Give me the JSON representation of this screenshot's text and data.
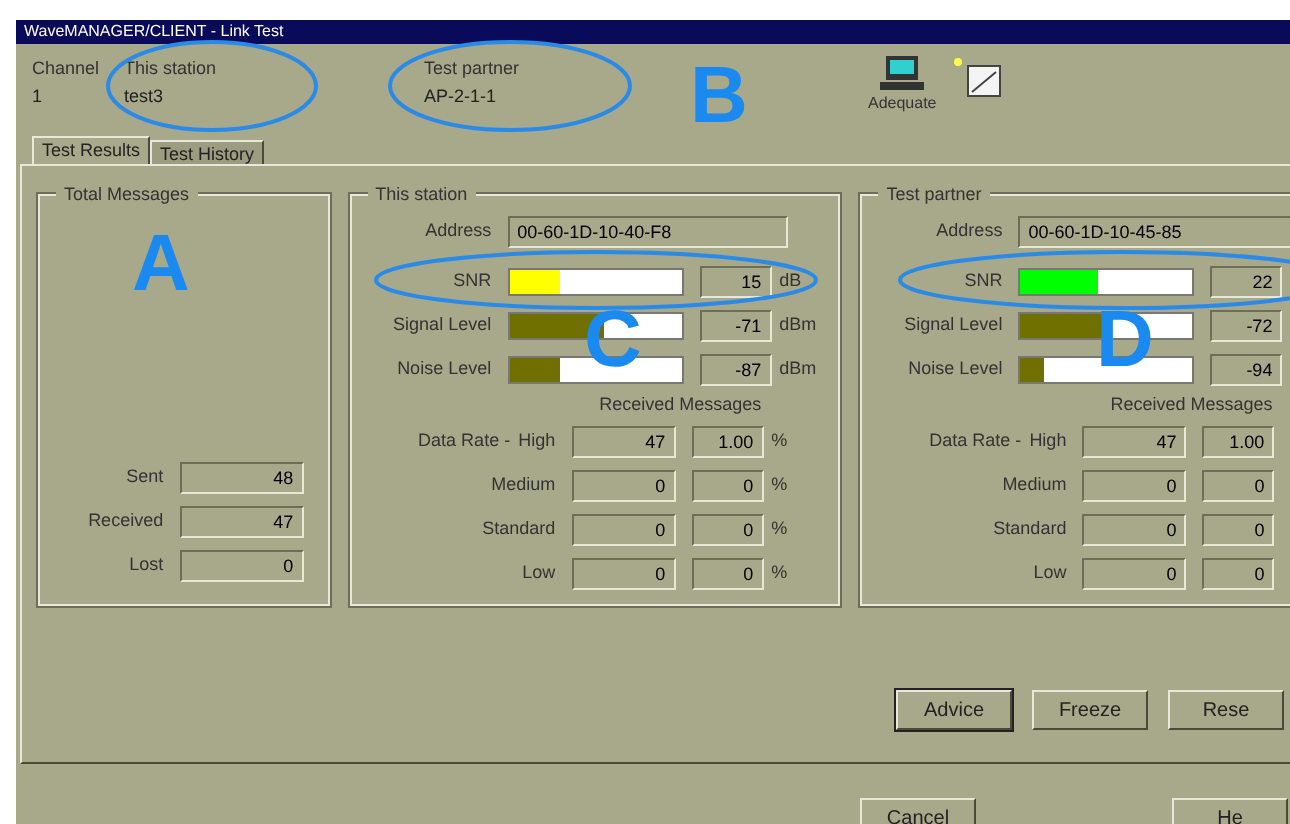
{
  "window": {
    "title": "WaveMANAGER/CLIENT - Link Test"
  },
  "header": {
    "channel": {
      "label": "Channel",
      "value": "1"
    },
    "this_station": {
      "label": "This station",
      "value": "test3"
    },
    "test_partner": {
      "label": "Test partner",
      "value": "AP-2-1-1"
    },
    "link_quality": "Adequate"
  },
  "tabs": [
    {
      "label": "Test Results",
      "selected": true
    },
    {
      "label": "Test History",
      "selected": false
    }
  ],
  "total_messages": {
    "title": "Total Messages",
    "rows": [
      {
        "label": "Sent",
        "value": "48"
      },
      {
        "label": "Received",
        "value": "47"
      },
      {
        "label": "Lost",
        "value": "0"
      }
    ]
  },
  "stations": [
    {
      "title": "This station",
      "address_label": "Address",
      "address": "00-60-1D-10-40-F8",
      "meters": [
        {
          "label": "SNR",
          "level": 0.3,
          "color": "#ffff00",
          "reading": "15",
          "unit": "dB"
        },
        {
          "label": "Signal Level",
          "level": 0.55,
          "color": "#707000",
          "reading": "-71",
          "unit": "dBm"
        },
        {
          "label": "Noise Level",
          "level": 0.3,
          "color": "#707000",
          "reading": "-87",
          "unit": "dBm"
        }
      ],
      "received_title": "Received Messages",
      "rate_label": "Data Rate -",
      "rates": [
        {
          "label": "High",
          "count": "47",
          "ratio": "1.00",
          "unit": "%"
        },
        {
          "label": "Medium",
          "count": "0",
          "ratio": "0",
          "unit": "%"
        },
        {
          "label": "Standard",
          "count": "0",
          "ratio": "0",
          "unit": "%"
        },
        {
          "label": "Low",
          "count": "0",
          "ratio": "0",
          "unit": "%"
        }
      ]
    },
    {
      "title": "Test partner",
      "address_label": "Address",
      "address": "00-60-1D-10-45-85",
      "meters": [
        {
          "label": "SNR",
          "level": 0.45,
          "color": "#00ff00",
          "reading": "22"
        },
        {
          "label": "Signal Level",
          "level": 0.53,
          "color": "#707000",
          "reading": "-72"
        },
        {
          "label": "Noise Level",
          "level": 0.14,
          "color": "#707000",
          "reading": "-94"
        }
      ],
      "received_title": "Received Messages",
      "rate_label": "Data Rate -",
      "rates": [
        {
          "label": "High",
          "count": "47",
          "ratio": "1.00"
        },
        {
          "label": "Medium",
          "count": "0",
          "ratio": "0"
        },
        {
          "label": "Standard",
          "count": "0",
          "ratio": "0"
        },
        {
          "label": "Low",
          "count": "0",
          "ratio": "0"
        }
      ]
    }
  ],
  "panel_buttons": [
    "Advice",
    "Freeze",
    "Rese"
  ],
  "dialog_buttons": [
    "Cancel",
    "He"
  ],
  "annotations": [
    "A",
    "B",
    "C",
    "D"
  ]
}
